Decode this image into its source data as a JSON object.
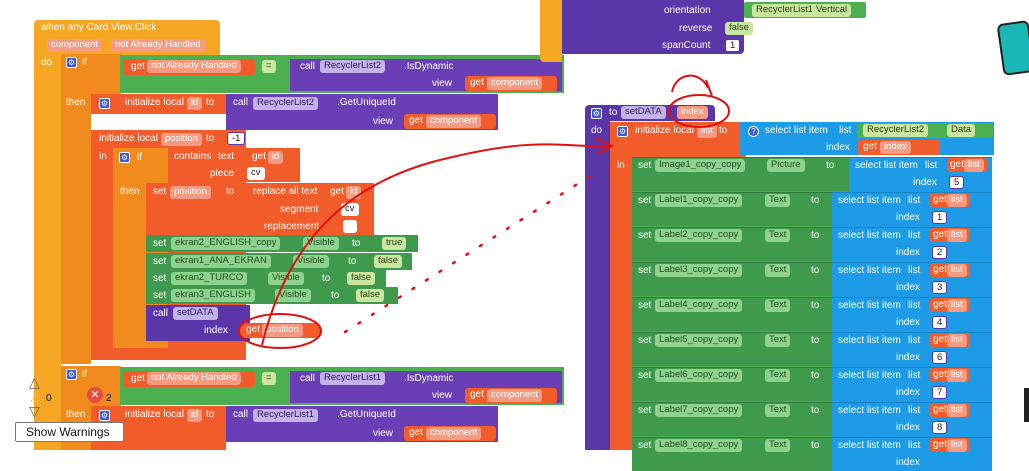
{
  "event": {
    "header": "when any Card View.Click",
    "param_component": "component",
    "param_handled": "not Already Handled",
    "do": "do"
  },
  "if1": {
    "if": "if",
    "get": "get",
    "not_handled": "not Already Handled",
    "eq": "=",
    "call": "call",
    "recycler": "RecyclerList2",
    "is_dynamic": ".IsDynamic",
    "view": "view",
    "get2": "get",
    "component": "component"
  },
  "then1": {
    "then": "then",
    "init_local": "initialize local",
    "id_var": "id",
    "to": "to",
    "call": "call",
    "recycler": "RecyclerList2",
    "get_unique": ".GetUniqueId",
    "view": "view",
    "get": "get",
    "component": "component"
  },
  "init_pos": {
    "label": "initialize local",
    "pos_var": "position",
    "to": "to",
    "value": "-1",
    "in": "in"
  },
  "if2": {
    "if": "if",
    "contains": "contains",
    "text": "text",
    "get": "get",
    "id": "id",
    "piece": "piece",
    "cv": "cv",
    "then": "then"
  },
  "setpos": {
    "set": "set",
    "position": "position",
    "to": "to",
    "replace_all": "replace all text",
    "get": "get",
    "id": "id",
    "segment": "segment",
    "cv": "cv",
    "replacement": "replacement",
    "empty": ""
  },
  "sets": [
    {
      "set": "set",
      "component": "ekran2_ENGLISH_copy",
      "prop": "Visible",
      "to": "to",
      "value": "true"
    },
    {
      "set": "set",
      "component": "ekran1_ANA_EKRAN",
      "prop": "Visible",
      "to": "to",
      "value": "false"
    },
    {
      "set": "set",
      "component": "ekran2_TURCO",
      "prop": "Visible",
      "to": "to",
      "value": "false"
    },
    {
      "set": "set",
      "component": "ekran3_ENGLISH",
      "prop": "Visible",
      "to": "to",
      "value": "false"
    }
  ],
  "call_setdata": {
    "call": "call",
    "proc": "setDATA",
    "index": "index",
    "get": "get",
    "position": "position"
  },
  "if3": {
    "if": "if",
    "get": "get",
    "not_handled": "not Already Handled",
    "eq": "=",
    "call": "call",
    "recycler": "RecyclerList1",
    "is_dynamic": ".IsDynamic",
    "view": "view",
    "get2": "get",
    "component": "component"
  },
  "then3": {
    "then": "then",
    "init_local": "initialize local",
    "id_var": "id",
    "to": "to",
    "call": "call",
    "recycler": "RecyclerList1",
    "get_unique": ".GetUniqueId",
    "view": "view",
    "get": "get",
    "component": "component"
  },
  "top_props": {
    "orientation": "orientation",
    "orient_comp": "RecyclerList1",
    "orient_val": "Vertical",
    "reverse": "reverse",
    "reverse_val": "false",
    "spancount": "spanCount",
    "span_val": "1"
  },
  "proc": {
    "to": "to",
    "name": "setDATA",
    "param": "index",
    "do": "do",
    "init_local": "initialize local",
    "list_var": "list",
    "to2": "to",
    "select": "select list item",
    "list": "list",
    "recycler": "RecyclerList2",
    "data": "Data",
    "index": "index",
    "get": "get",
    "index_var": "index",
    "in": "in"
  },
  "proc_sets": [
    {
      "set": "set",
      "component": "Image1_copy_copy",
      "prop": "Picture",
      "to": "to",
      "select": "select list item",
      "list": "list",
      "get": "get",
      "list_var": "list",
      "index": "index",
      "num": "5"
    },
    {
      "set": "set",
      "component": "Label1_copy_copy",
      "prop": "Text",
      "to": "to",
      "select": "select list item",
      "list": "list",
      "get": "get",
      "list_var": "list",
      "index": "index",
      "num": "1"
    },
    {
      "set": "set",
      "component": "Label2_copy_copy",
      "prop": "Text",
      "to": "to",
      "select": "select list item",
      "list": "list",
      "get": "get",
      "list_var": "list",
      "index": "index",
      "num": "2"
    },
    {
      "set": "set",
      "component": "Label3_copy_copy",
      "prop": "Text",
      "to": "to",
      "select": "select list item",
      "list": "list",
      "get": "get",
      "list_var": "list",
      "index": "index",
      "num": "3"
    },
    {
      "set": "set",
      "component": "Label4_copy_copy",
      "prop": "Text",
      "to": "to",
      "select": "select list item",
      "list": "list",
      "get": "get",
      "list_var": "list",
      "index": "index",
      "num": "4"
    },
    {
      "set": "set",
      "component": "Label5_copy_copy",
      "prop": "Text",
      "to": "to",
      "select": "select list item",
      "list": "list",
      "get": "get",
      "list_var": "list",
      "index": "index",
      "num": "6"
    },
    {
      "set": "set",
      "component": "Label6_copy_copy",
      "prop": "Text",
      "to": "to",
      "select": "select list item",
      "list": "list",
      "get": "get",
      "list_var": "list",
      "index": "index",
      "num": "7"
    },
    {
      "set": "set",
      "component": "Label7_copy_copy",
      "prop": "Text",
      "to": "to",
      "select": "select list item",
      "list": "list",
      "get": "get",
      "list_var": "list",
      "index": "index",
      "num": "8"
    },
    {
      "set": "set",
      "component": "Label8_copy_copy",
      "prop": "Text",
      "to": "to",
      "select": "select list item",
      "list": "list",
      "get": "get",
      "list_var": "list",
      "index": "index",
      "num": ""
    }
  ],
  "warnings": {
    "warn_count": "0",
    "error_count": "2",
    "show_warnings": "Show Warnings"
  }
}
